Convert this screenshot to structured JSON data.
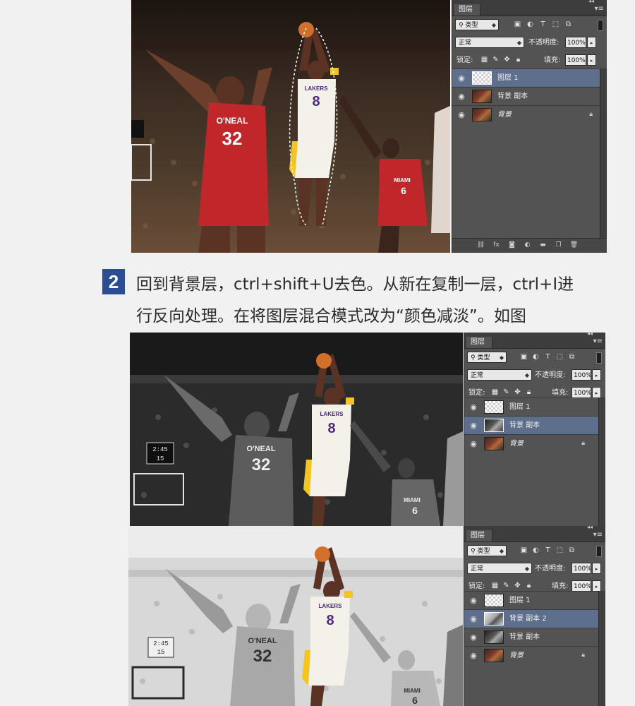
{
  "step": {
    "number": "2",
    "line1": "回到背景层，ctrl+shift+U去色。从新在复制一层，ctrl+I进",
    "line2": "行反向处理。在将图层混合模式改为“颜色减淡”。如图"
  },
  "panels": [
    {
      "tab": "图层",
      "filter_kind": "类型",
      "blend_mode": "正常",
      "opacity_label": "不透明度:",
      "opacity_value": "100%",
      "lock_label": "锁定:",
      "fill_label": "填充:",
      "fill_value": "100%",
      "layers": [
        {
          "name": "图层 1",
          "selected": true
        },
        {
          "name": "背景 副本",
          "selected": false
        },
        {
          "name": "背景",
          "selected": false
        }
      ]
    },
    {
      "tab": "图层",
      "filter_kind": "类型",
      "blend_mode": "正常",
      "opacity_label": "不透明度:",
      "opacity_value": "100%",
      "lock_label": "锁定:",
      "fill_label": "填充:",
      "fill_value": "100%",
      "layers": [
        {
          "name": "图层 1",
          "selected": false
        },
        {
          "name": "背景 副本",
          "selected": true
        },
        {
          "name": "背景",
          "selected": false
        }
      ]
    },
    {
      "tab": "图层",
      "filter_kind": "类型",
      "blend_mode": "正常",
      "opacity_label": "不透明度:",
      "opacity_value": "100%",
      "lock_label": "锁定:",
      "fill_label": "填充:",
      "fill_value": "100%",
      "layers": [
        {
          "name": "图层 1",
          "selected": false
        },
        {
          "name": "背景 副本 2",
          "selected": true
        },
        {
          "name": "背景 副本",
          "selected": false
        },
        {
          "name": "背景",
          "selected": false
        }
      ]
    }
  ],
  "photo": {
    "jersey_center": "8",
    "jersey_left": "32",
    "jersey_right": "6",
    "team_center": "LAKERS",
    "team_left": "O'NEAL",
    "team_right": "MIAMI",
    "clock_a": "2:45",
    "clock_b": "15"
  },
  "colors": {
    "accent": "#2a4d93",
    "panel_bg": "#535353",
    "selected_layer": "#5d6f8c",
    "heat_red": "#c0262a",
    "lakers_gold": "#f4c425"
  }
}
